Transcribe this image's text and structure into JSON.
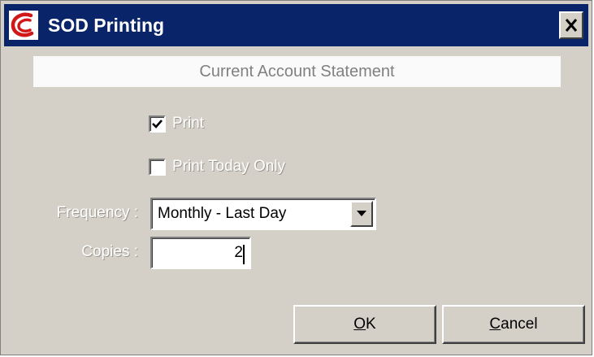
{
  "window": {
    "title": "SOD Printing",
    "app_icon": "letter-c-logo-icon",
    "close_icon": "close-x-icon"
  },
  "header": {
    "title": "Current Account Statement"
  },
  "options": {
    "print": {
      "label": "Print",
      "checked": true
    },
    "print_today_only": {
      "label": "Print Today Only",
      "checked": false
    }
  },
  "frequency": {
    "label": "Frequency :",
    "selected": "Monthly - Last Day",
    "arrow_icon": "chevron-down-icon"
  },
  "copies": {
    "label": "Copies :",
    "value": "2"
  },
  "buttons": {
    "ok": {
      "mnemonic": "O",
      "rest": "K"
    },
    "cancel": {
      "mnemonic": "C",
      "rest": "ancel"
    }
  },
  "colors": {
    "title_bar": "#0a246a",
    "face": "#d4d0c8",
    "logo": "#d01818"
  }
}
